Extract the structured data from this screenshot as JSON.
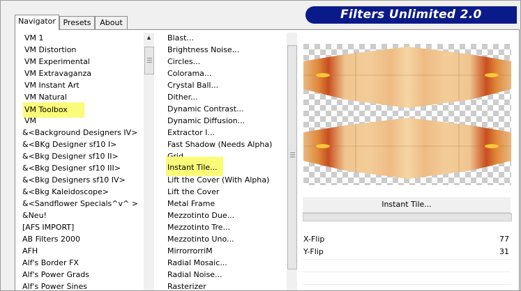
{
  "app": {
    "title": "Filters Unlimited 2.0"
  },
  "tabs": [
    {
      "label": "Navigator",
      "active": true
    },
    {
      "label": "Presets",
      "active": false
    },
    {
      "label": "About",
      "active": false
    }
  ],
  "categories": [
    {
      "label": "VM 1"
    },
    {
      "label": "VM Distortion"
    },
    {
      "label": "VM Experimental"
    },
    {
      "label": "VM Extravaganza"
    },
    {
      "label": "VM Instant Art"
    },
    {
      "label": "VM Natural"
    },
    {
      "label": "VM Toolbox",
      "highlight": true
    },
    {
      "label": "VM"
    },
    {
      "label": "&<Background Designers IV>"
    },
    {
      "label": "&<BKg Designer sf10 I>"
    },
    {
      "label": "&<Bkg Designer sf10 II>"
    },
    {
      "label": "&<Bkg Designer sf10 III>"
    },
    {
      "label": "&<Bkg Designers sf10 IV>"
    },
    {
      "label": "&<Bkg Kaleidoscope>"
    },
    {
      "label": "&<Sandflower Specials^v^ >"
    },
    {
      "label": "&Neu!"
    },
    {
      "label": "[AFS IMPORT]"
    },
    {
      "label": "AB Filters 2000"
    },
    {
      "label": "AFH"
    },
    {
      "label": "Alf's Border FX"
    },
    {
      "label": "Alf's Power Grads"
    },
    {
      "label": "Alf's Power Sines"
    }
  ],
  "filters": [
    {
      "label": "Blast..."
    },
    {
      "label": "Brightness Noise..."
    },
    {
      "label": "Circles..."
    },
    {
      "label": "Colorama..."
    },
    {
      "label": "Crystal Ball..."
    },
    {
      "label": "Dither..."
    },
    {
      "label": "Dynamic Contrast..."
    },
    {
      "label": "Dynamic Diffusion..."
    },
    {
      "label": "Extractor I..."
    },
    {
      "label": "Fast Shadow (Needs Alpha)"
    },
    {
      "label": "Grid..."
    },
    {
      "label": "Instant Tile...",
      "highlight": true
    },
    {
      "label": "Lift the Cover (With Alpha)"
    },
    {
      "label": "Lift the Cover"
    },
    {
      "label": "Metal Frame"
    },
    {
      "label": "Mezzotinto Due..."
    },
    {
      "label": "Mezzotinto Tre..."
    },
    {
      "label": "Mezzotinto Uno..."
    },
    {
      "label": "MirrorrorriM"
    },
    {
      "label": "Radial Mosaic..."
    },
    {
      "label": "Radial Noise..."
    },
    {
      "label": "Rasterizer"
    }
  ],
  "selected_filter": {
    "label": "Instant Tile..."
  },
  "params": [
    {
      "label": "X-Flip",
      "value": "77"
    },
    {
      "label": "Y-Flip",
      "value": "31"
    }
  ],
  "colors": {
    "banner": "#0b1a8a",
    "highlight": "#fbfb7a"
  }
}
